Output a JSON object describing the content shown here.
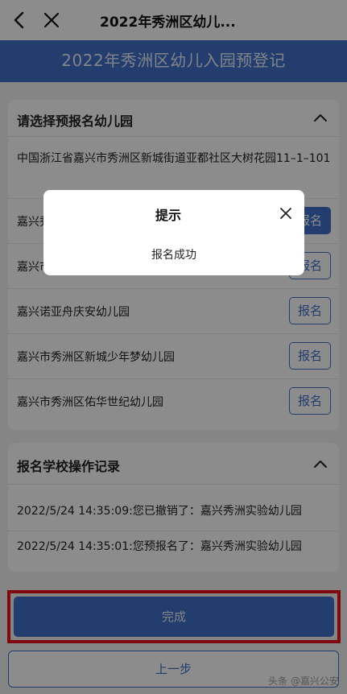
{
  "nav": {
    "title": "2022年秀洲区幼儿..."
  },
  "banner": {
    "text": "2022年秀洲区幼儿入园预登记"
  },
  "select_section": {
    "title": "请选择预报名幼儿园",
    "address": "中国浙江省嘉兴市秀洲区新城街道亚都社区大树花园11–1–101",
    "kindergartens": [
      {
        "name": "嘉兴秀洲实验幼儿园",
        "button": "报名"
      },
      {
        "name": "嘉兴市秀洲区新城幼儿园",
        "button": "报名"
      },
      {
        "name": "嘉兴诺亚舟庆安幼儿园",
        "button": "报名"
      },
      {
        "name": "嘉兴市秀洲区新城少年梦幼儿园",
        "button": "报名"
      },
      {
        "name": "嘉兴市秀洲区佑华世纪幼儿园",
        "button": "报名"
      }
    ]
  },
  "log_section": {
    "title": "报名学校操作记录",
    "entries": [
      "2022/5/24 14:35:09:您已撤销了：嘉兴秀洲实验幼儿园",
      "2022/5/24 14:35:01:您预报名了：嘉兴秀洲实验幼儿园"
    ]
  },
  "buttons": {
    "done": "完成",
    "prev": "上一步"
  },
  "dialog": {
    "title": "提示",
    "message": "报名成功"
  },
  "watermark": "头条 @嘉兴公安",
  "colors": {
    "primary": "#3e6fc8",
    "highlight_frame": "#e8101a"
  }
}
